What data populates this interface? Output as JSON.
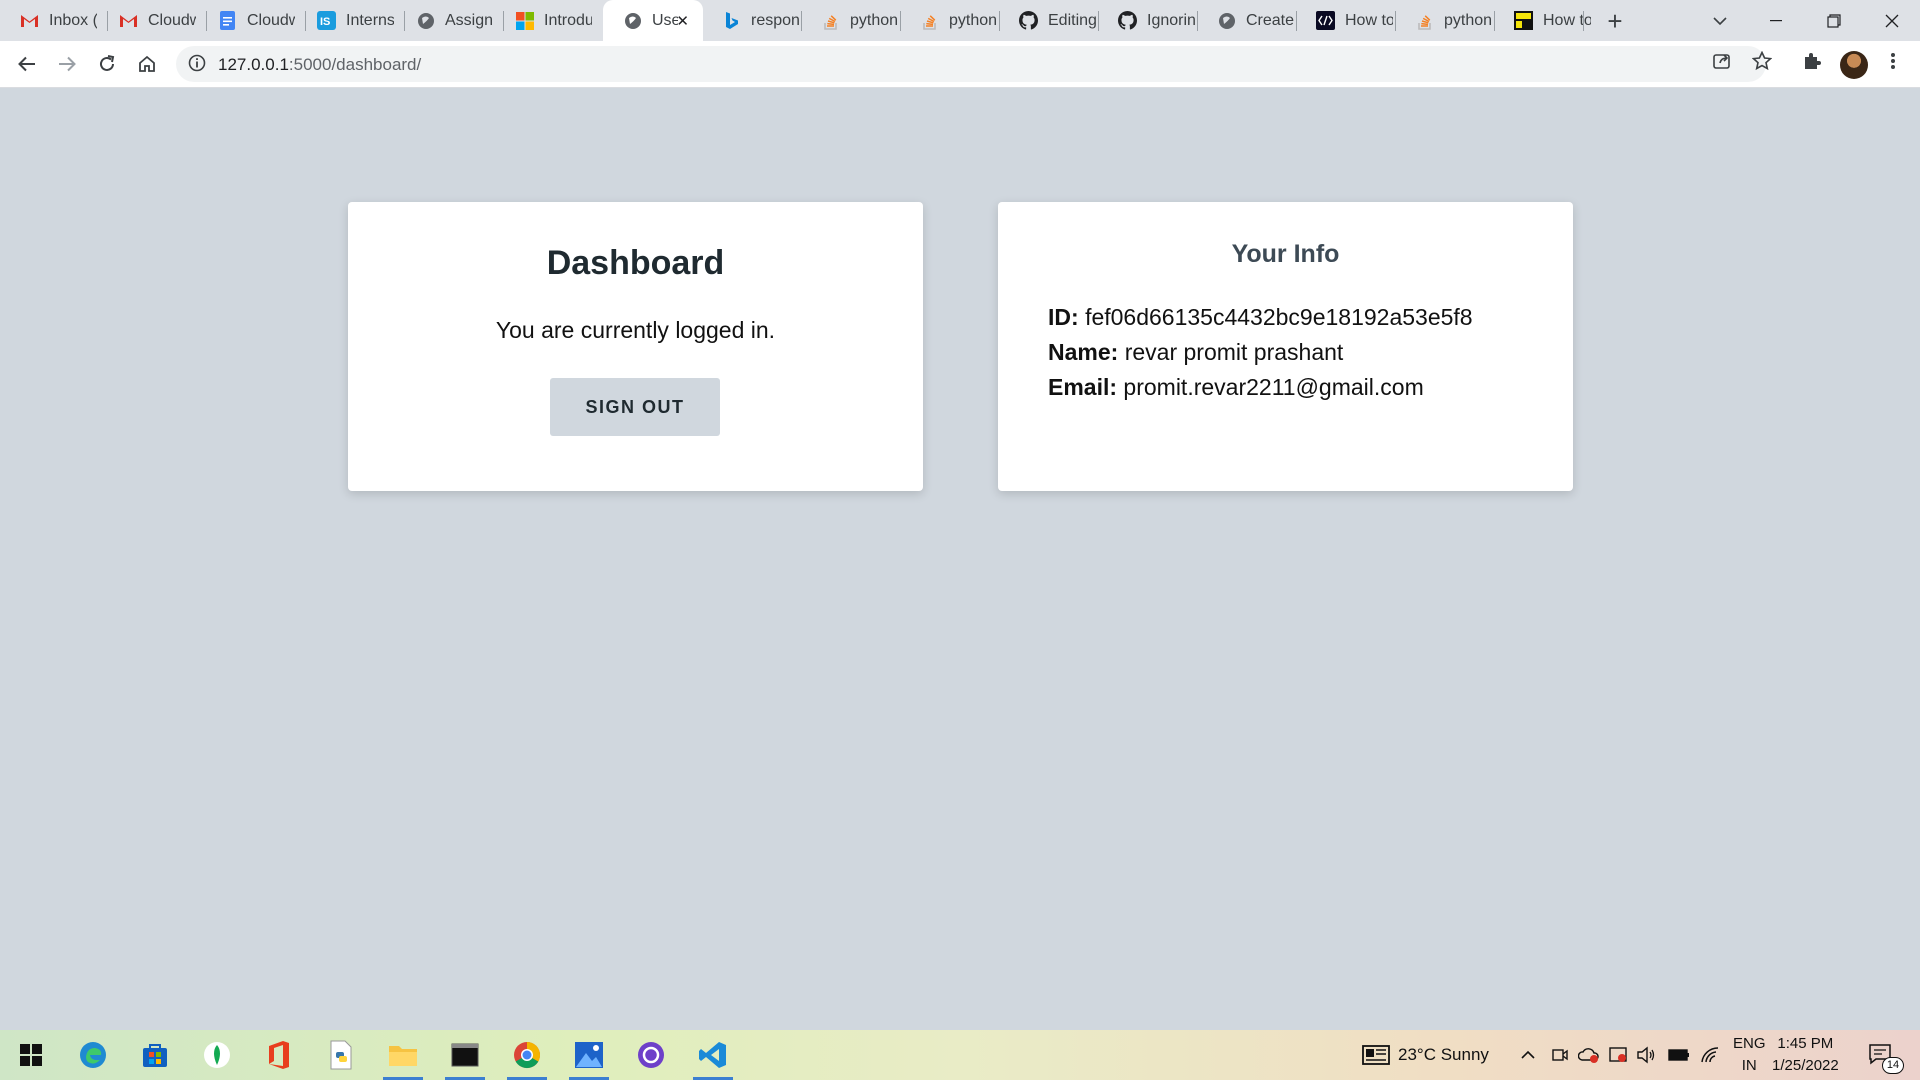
{
  "browser": {
    "tabs": [
      {
        "label": "Inbox (",
        "icon": "gmail-icon"
      },
      {
        "label": "Cloudw",
        "icon": "gmail-icon"
      },
      {
        "label": "Cloudw",
        "icon": "google-docs-icon"
      },
      {
        "label": "Interns",
        "icon": "internshala-icon"
      },
      {
        "label": "Assignr",
        "icon": "globe-icon"
      },
      {
        "label": "Introdu",
        "icon": "microsoft-icon"
      },
      {
        "label": "Use",
        "icon": "globe-icon",
        "active": true
      },
      {
        "label": "respon",
        "icon": "bing-icon"
      },
      {
        "label": "python",
        "icon": "stackoverflow-icon"
      },
      {
        "label": "python",
        "icon": "stackoverflow-icon"
      },
      {
        "label": "Editing",
        "icon": "github-icon"
      },
      {
        "label": "Ignorin",
        "icon": "github-icon"
      },
      {
        "label": "Create",
        "icon": "globe-icon"
      },
      {
        "label": "How to",
        "icon": "dev-icon"
      },
      {
        "label": "python",
        "icon": "stackoverflow-icon"
      },
      {
        "label": "How to",
        "icon": "geeks-icon"
      }
    ],
    "url_host": "127.0.0.1",
    "url_path": ":5000/dashboard/"
  },
  "dashboard": {
    "title": "Dashboard",
    "status_text": "You are currently logged in.",
    "signout_label": "SIGN OUT"
  },
  "info": {
    "title": "Your Info",
    "id_label": "ID:",
    "id_value": "fef06d66135c4432bc9e18192a53e5f8",
    "name_label": "Name:",
    "name_value": "revar promit prashant",
    "email_label": "Email:",
    "email_value": "promit.revar2211@gmail.com"
  },
  "taskbar": {
    "weather": "23°C  Sunny",
    "lang_top": "ENG",
    "lang_bottom": "IN",
    "time": "1:45 PM",
    "date": "1/25/2022",
    "notifications": "14"
  },
  "colors": {
    "page_bg": "#d0d7de",
    "card_bg": "#ffffff",
    "button_bg": "#d0d7de"
  }
}
